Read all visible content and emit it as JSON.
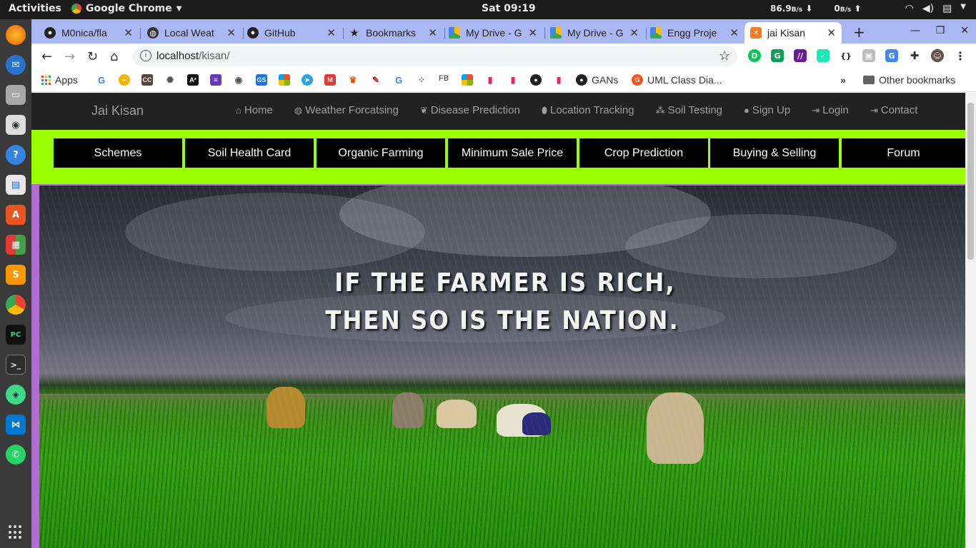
{
  "system": {
    "activities": "Activities",
    "app_name": "Google Chrome",
    "clock": "Sat 09:19",
    "net_down": "86.9",
    "net_down_unit": "B/s",
    "net_up": "0",
    "net_up_unit": "B/s"
  },
  "browser": {
    "tabs": [
      {
        "label": "M0nica/fla",
        "icon": "github-icon"
      },
      {
        "label": "Local Weat",
        "icon": "globe-icon"
      },
      {
        "label": "GitHub",
        "icon": "github-icon"
      },
      {
        "label": "Bookmarks",
        "icon": "star-icon"
      },
      {
        "label": "My Drive - G",
        "icon": "drive-icon"
      },
      {
        "label": "My Drive - G",
        "icon": "drive-icon"
      },
      {
        "label": "Engg Proje",
        "icon": "drive-icon"
      },
      {
        "label": "jai Kisan",
        "icon": "xampp-icon"
      }
    ],
    "active_tab": 7,
    "url_host": "localhost",
    "url_path": "/kisan/",
    "bookmarks": [
      {
        "label": "Apps"
      },
      {
        "label": "FB"
      },
      {
        "label": "GANs"
      },
      {
        "label": "UML Class Dia..."
      }
    ],
    "other_bookmarks": "Other bookmarks"
  },
  "site": {
    "brand": "Jai Kisan",
    "nav": [
      {
        "label": "Home",
        "icon": "home-icon"
      },
      {
        "label": "Weather Forcatsing",
        "icon": "globe-icon"
      },
      {
        "label": "Disease Prediction",
        "icon": "leaf-icon"
      },
      {
        "label": "Location Tracking",
        "icon": "map-marker-icon"
      },
      {
        "label": "Soil Testing",
        "icon": "grain-icon"
      },
      {
        "label": "Sign Up",
        "icon": "user-icon"
      },
      {
        "label": "Login",
        "icon": "login-icon"
      },
      {
        "label": "Contact",
        "icon": "login-icon"
      }
    ],
    "menu": [
      {
        "label": "Schemes"
      },
      {
        "label": "Soil Health Card"
      },
      {
        "label": "Organic Farming"
      },
      {
        "label": "Minimum Sale Price"
      },
      {
        "label": "Crop Prediction"
      },
      {
        "label": "Buying & Selling"
      },
      {
        "label": "Forum"
      }
    ],
    "hero_quote_line1": "IF THE FARMER IS RICH,",
    "hero_quote_line2": "THEN SO IS THE NATION."
  },
  "colors": {
    "menu_band": "#99ff00",
    "navbar": "#222222",
    "tabstrip": "#a9b8f2",
    "page_background": "#b06fd0"
  }
}
